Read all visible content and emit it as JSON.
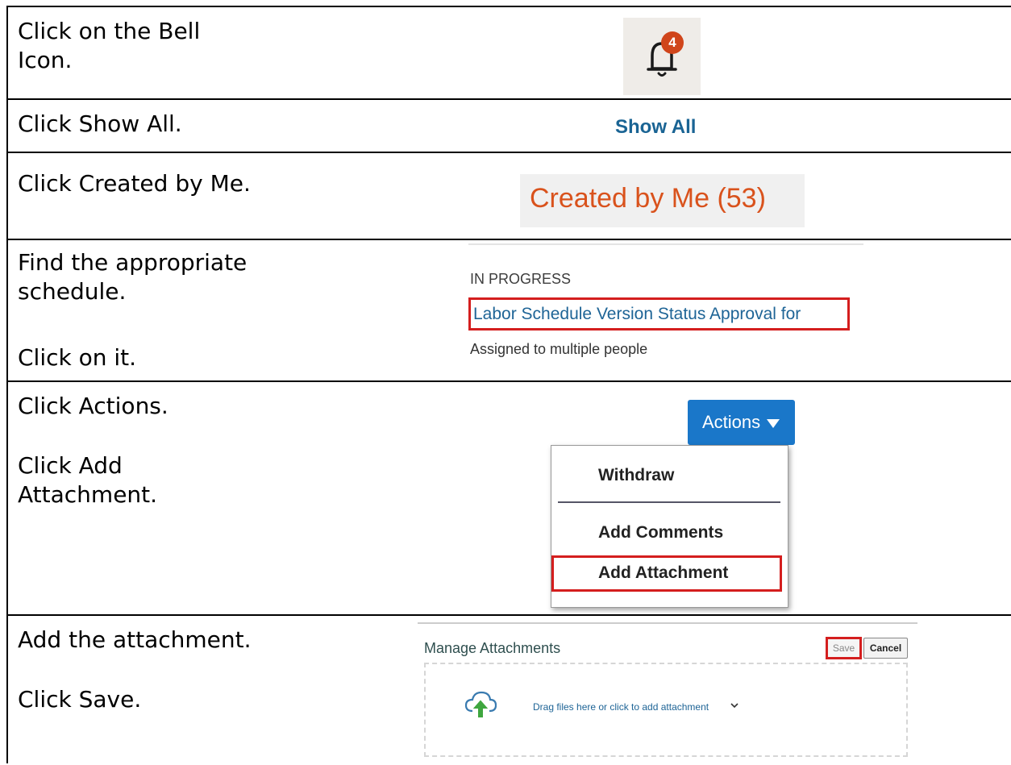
{
  "steps": {
    "bell": {
      "instruction": "Click on the Bell Icon.",
      "badge_count": "4"
    },
    "show_all": {
      "instruction": "Click Show All.",
      "link_label": "Show All"
    },
    "created": {
      "instruction": "Click Created by Me.",
      "tab_label": "Created by Me (53)"
    },
    "schedule": {
      "instruction_1": "Find the appropriate schedule.",
      "instruction_2": "Click on it.",
      "status": "IN PROGRESS",
      "link": "Labor Schedule Version Status Approval for",
      "assigned": "Assigned to multiple people"
    },
    "actions": {
      "instruction_1": "Click Actions.",
      "instruction_2": "Click Add Attachment.",
      "button_label": "Actions",
      "menu": [
        "Withdraw",
        "Add Comments",
        "Add Attachment"
      ]
    },
    "attach": {
      "instruction_1": "Add the attachment.",
      "instruction_2": "Click Save.",
      "title": "Manage Attachments",
      "save_label": "Save",
      "cancel_label": "Cancel",
      "drop_text": "Drag files here or click to add attachment"
    }
  },
  "colors": {
    "highlight": "#d41e1e",
    "link_blue": "#1e6496",
    "badge": "#d0451b",
    "orange_text": "#d9521c",
    "actions_btn": "#1a77c9"
  },
  "icons": [
    "bell-icon",
    "cloud-upload-icon",
    "chevron-down-icon",
    "caret-down-icon"
  ]
}
